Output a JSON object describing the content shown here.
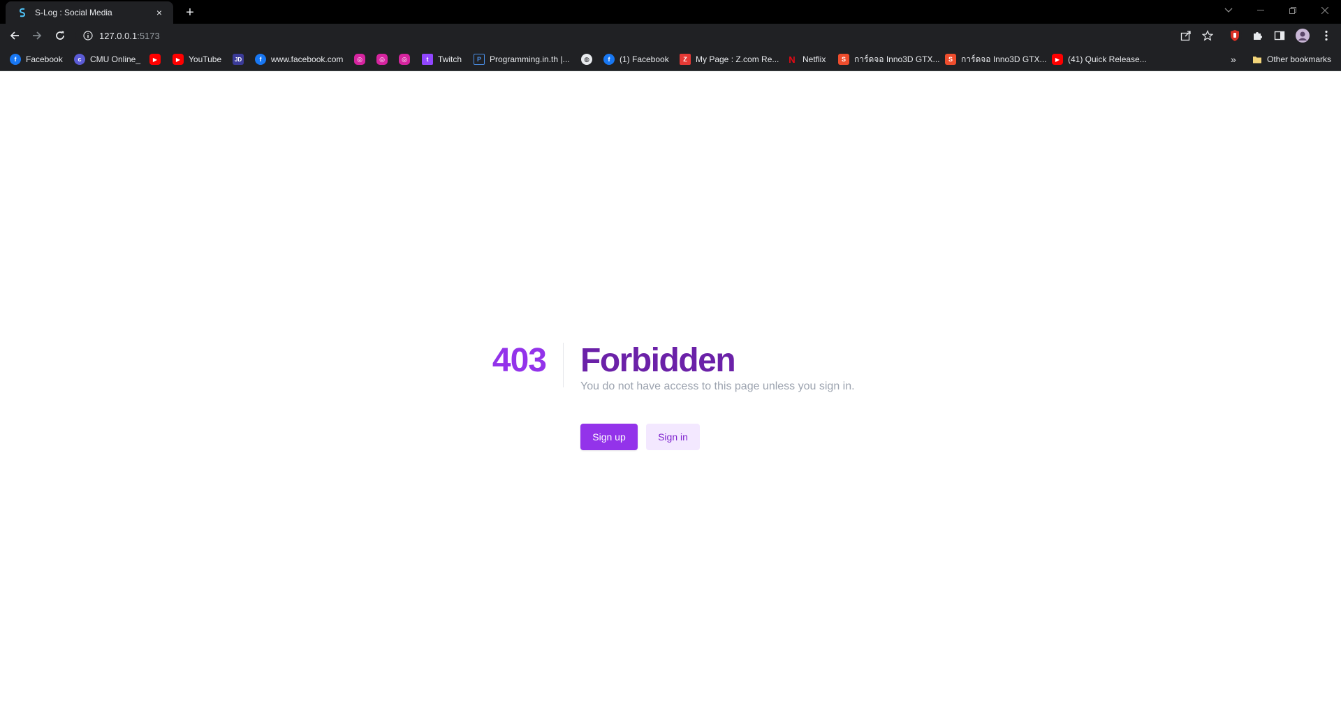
{
  "tab": {
    "title": "S-Log : Social Media",
    "close": "×",
    "new_tab": "+"
  },
  "omnibox": {
    "host": "127.0.0.1",
    "port": ":5173"
  },
  "bookmarks": {
    "items": [
      {
        "label": "Facebook",
        "icon": "facebook-icon",
        "color": "#1877f2"
      },
      {
        "label": "CMU Online_",
        "icon": "cmu-icon",
        "color": "#5b5bd6"
      },
      {
        "label": "",
        "icon": "youtube-icon",
        "color": "#ff0000"
      },
      {
        "label": "YouTube",
        "icon": "youtube-icon",
        "color": "#ff0000"
      },
      {
        "label": "",
        "icon": "jd-icon",
        "color": "#3b3b98"
      },
      {
        "label": "www.facebook.com",
        "icon": "facebook-icon",
        "color": "#1877f2"
      },
      {
        "label": "",
        "icon": "instagram-icon",
        "color": "#d6249f"
      },
      {
        "label": "",
        "icon": "instagram-icon",
        "color": "#d6249f"
      },
      {
        "label": "",
        "icon": "instagram-icon",
        "color": "#d6249f"
      },
      {
        "label": "Twitch",
        "icon": "twitch-icon",
        "color": "#9146ff"
      },
      {
        "label": "Programming.in.th |...",
        "icon": "programming-icon",
        "color": "#4a8fe7"
      },
      {
        "label": "",
        "icon": "globe-icon",
        "color": "#e8eaed"
      },
      {
        "label": "(1) Facebook",
        "icon": "facebook-icon",
        "color": "#1877f2"
      },
      {
        "label": "My Page : Z.com Re...",
        "icon": "zcom-icon",
        "color": "#e53935"
      },
      {
        "label": "Netflix",
        "icon": "netflix-icon",
        "color": "#e50914"
      },
      {
        "label": "การ์ดจอ Inno3D GTX...",
        "icon": "shop-icon",
        "color": "#ee4d2d"
      },
      {
        "label": "การ์ดจอ Inno3D GTX...",
        "icon": "shop-icon",
        "color": "#ee4d2d"
      },
      {
        "label": "(41) Quick Release...",
        "icon": "youtube-icon",
        "color": "#ff0000"
      }
    ],
    "overflow": "»",
    "other": "Other bookmarks"
  },
  "error": {
    "code": "403",
    "title": "Forbidden",
    "message": "You do not have access to this page unless you sign in."
  },
  "actions": {
    "signup": "Sign up",
    "signin": "Sign in"
  },
  "colors": {
    "accent": "#9333ea",
    "title": "#6b21a8",
    "signin_bg": "#f3e8ff"
  }
}
